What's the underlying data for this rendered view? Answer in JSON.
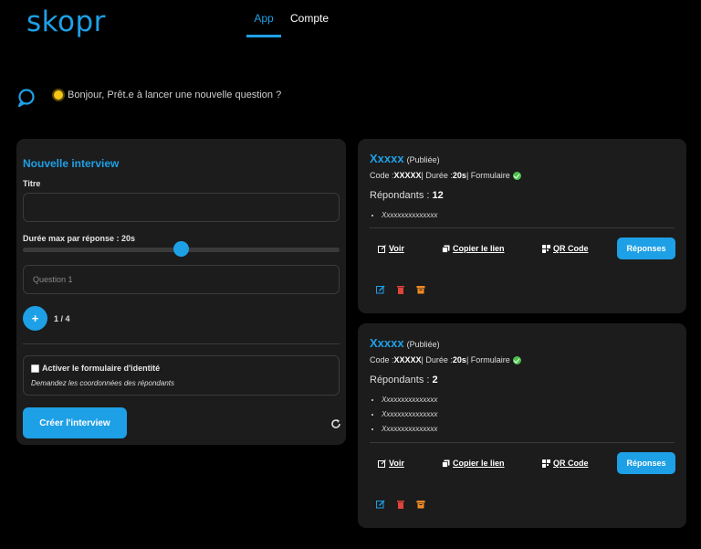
{
  "header": {
    "logo": "skopr",
    "tabs": [
      {
        "label": "App",
        "active": true
      },
      {
        "label": "Compte",
        "active": false
      }
    ]
  },
  "greeting": "Bonjour, Prêt.e à lancer une nouvelle question ?",
  "form": {
    "title": "Nouvelle interview",
    "titre_label": "Titre",
    "titre_value": "",
    "duration_label": "Durée max par réponse : 20s",
    "duration_fraction": 0.5,
    "question_placeholder": "Question 1",
    "add_label": "+",
    "count": "1 / 4",
    "identity_label": "Activer le formulaire d'identité",
    "identity_checked": false,
    "identity_desc": "Demandez les coordonnées des répondants",
    "create_label": "Créer l'interview"
  },
  "interviews": [
    {
      "name": "Xxxxx",
      "status": "(Publiée)",
      "code_label": "Code : ",
      "code": "XXXXX",
      "duree_label": " | Durée : ",
      "duree": "20s",
      "formulaire": " | Formulaire",
      "respondants_label": "Répondants : ",
      "respondants": "12",
      "items": [
        "Xxxxxxxxxxxxxxx"
      ],
      "voir": "Voir",
      "copier": "Copier le lien",
      "qr": "QR Code",
      "reponses": "Réponses"
    },
    {
      "name": "Xxxxx",
      "status": "(Publiée)",
      "code_label": "Code : ",
      "code": "XXXXX",
      "duree_label": " | Durée : ",
      "duree": "20s",
      "formulaire": " | Formulaire",
      "respondants_label": "Répondants : ",
      "respondants": "2",
      "items": [
        "Xxxxxxxxxxxxxxx",
        "Xxxxxxxxxxxxxxx",
        "Xxxxxxxxxxxxxxx"
      ],
      "voir": "Voir",
      "copier": "Copier le lien",
      "qr": "QR Code",
      "reponses": "Réponses"
    }
  ],
  "colors": {
    "accent": "#1ea0e6",
    "background": "#000000",
    "card": "#1c1c1c",
    "success": "#4cc24c",
    "delete": "#e0443a",
    "archive": "#f08a24"
  }
}
